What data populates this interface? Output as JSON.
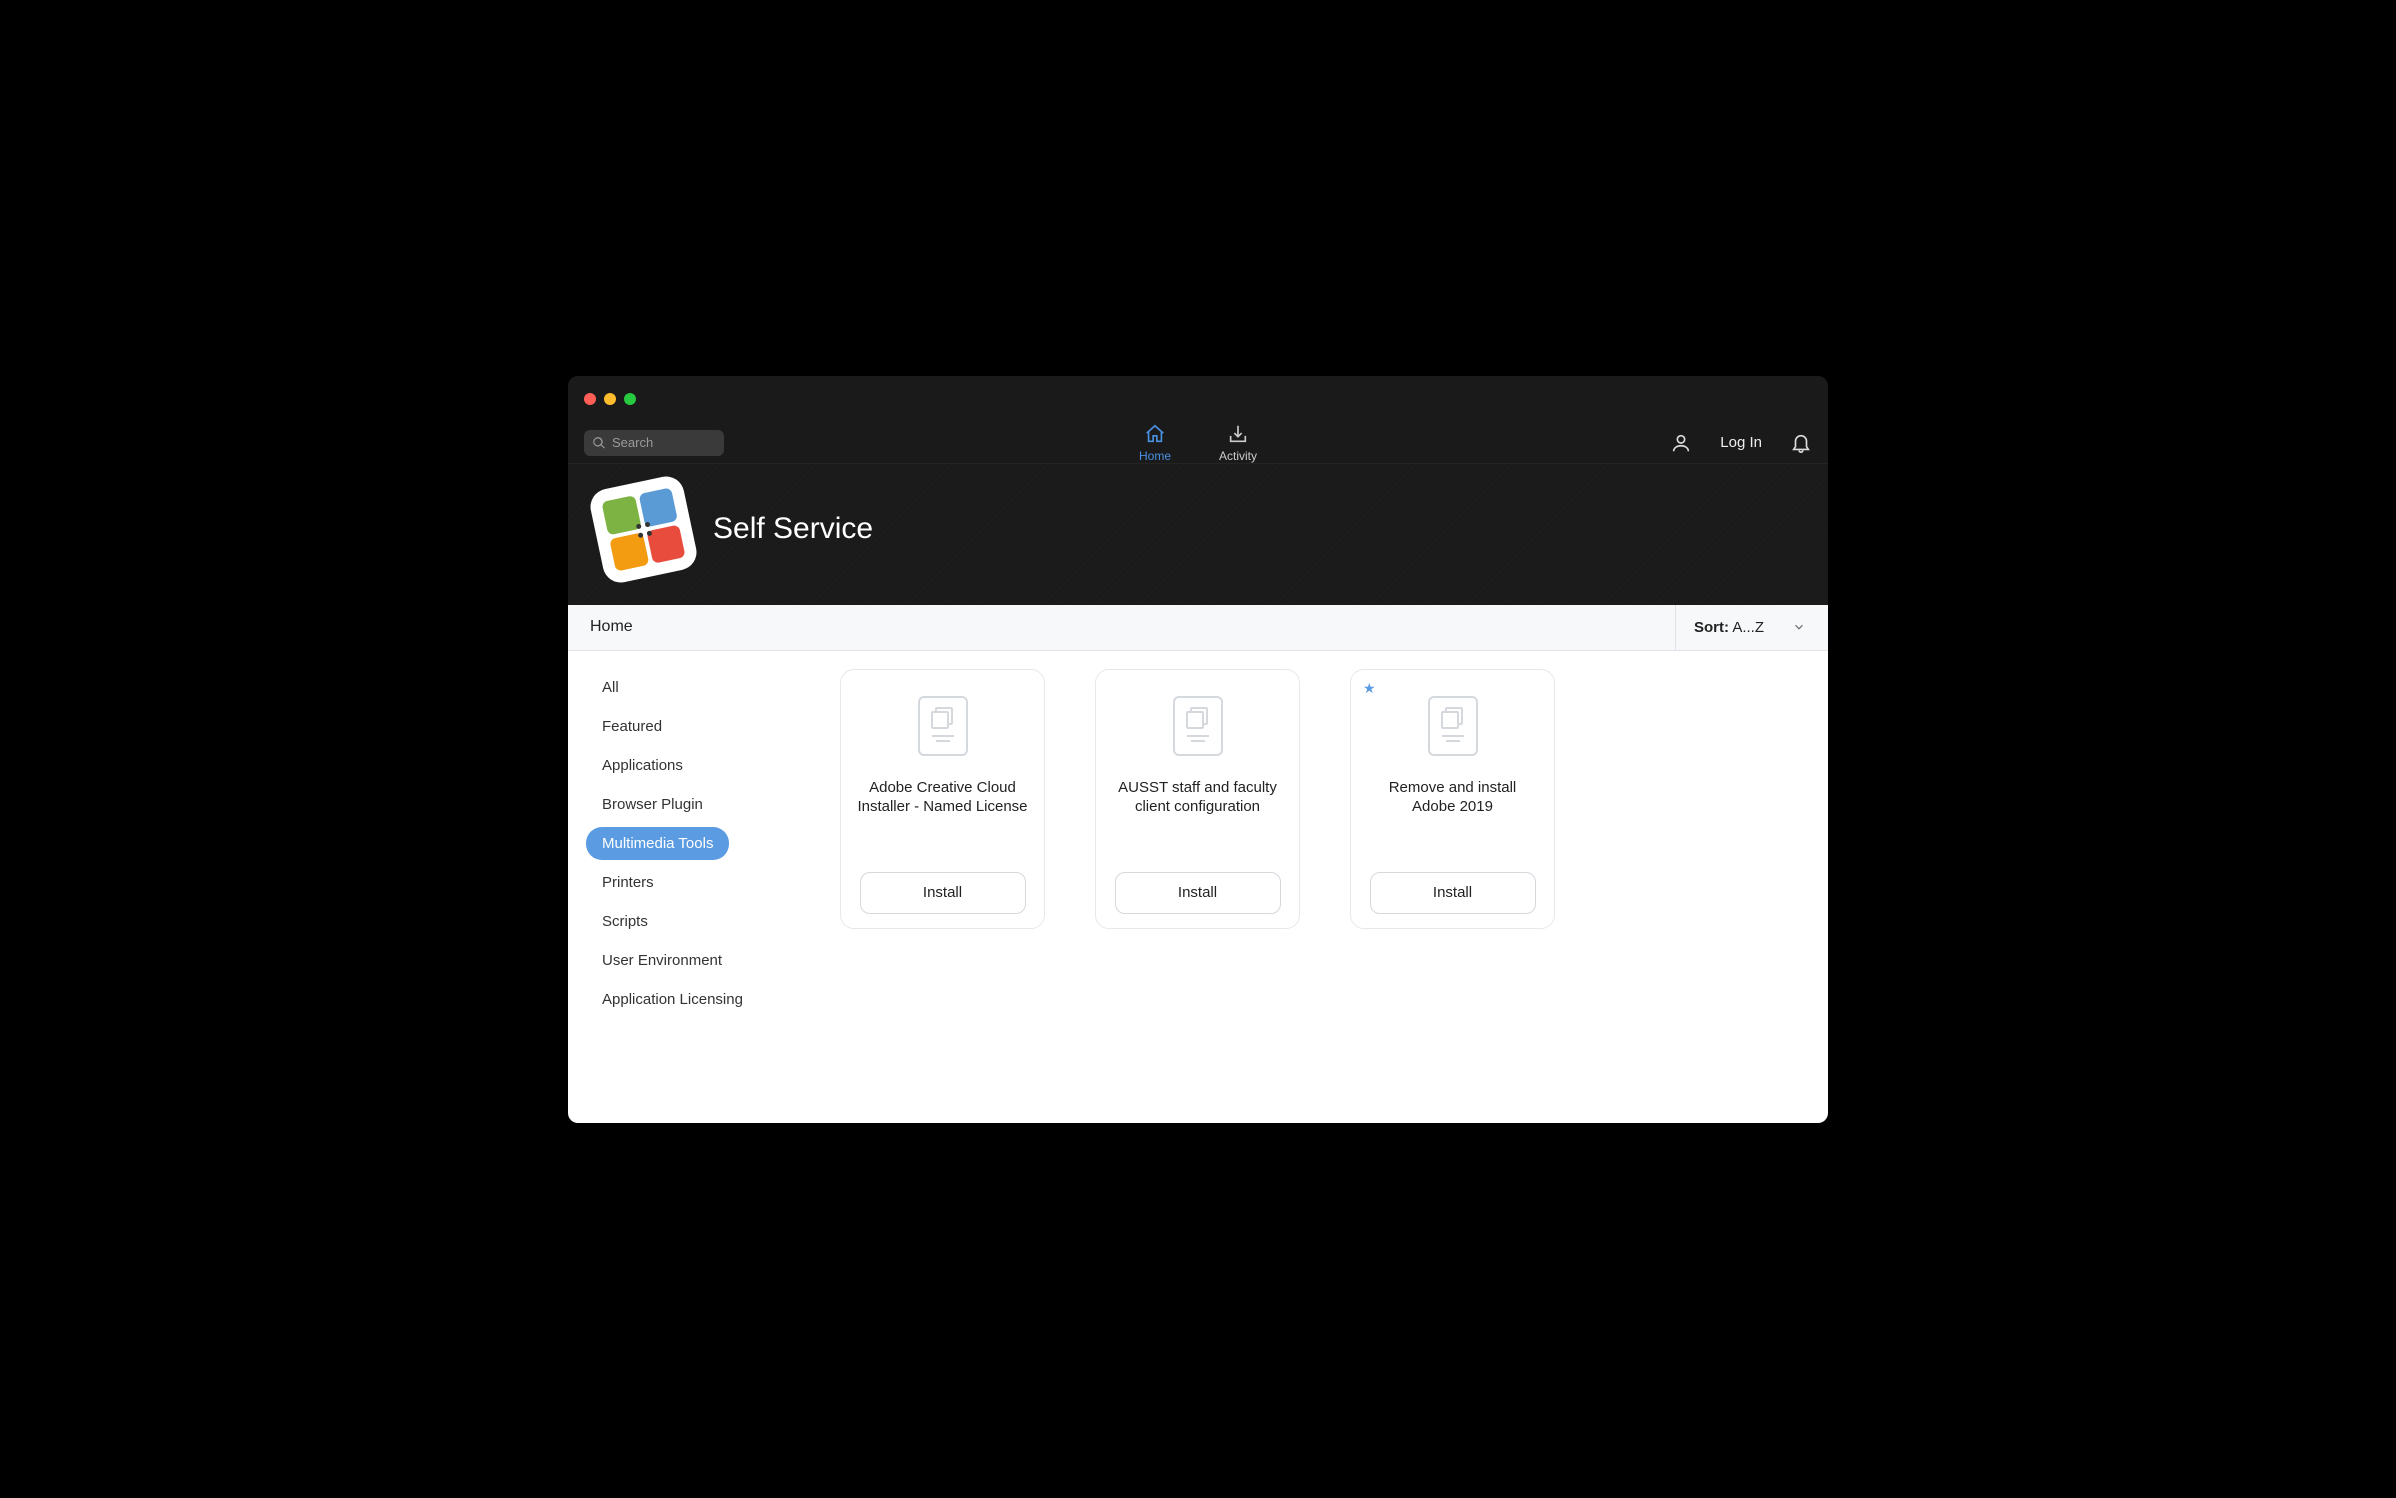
{
  "search": {
    "placeholder": "Search"
  },
  "nav": {
    "home": "Home",
    "activity": "Activity"
  },
  "auth": {
    "login": "Log In"
  },
  "app": {
    "title": "Self Service"
  },
  "breadcrumb": "Home",
  "sort": {
    "label": "Sort:",
    "value": "A...Z"
  },
  "sidebar": {
    "items": [
      {
        "label": "All",
        "active": false
      },
      {
        "label": "Featured",
        "active": false
      },
      {
        "label": "Applications",
        "active": false
      },
      {
        "label": "Browser Plugin",
        "active": false
      },
      {
        "label": "Multimedia Tools",
        "active": true
      },
      {
        "label": "Printers",
        "active": false
      },
      {
        "label": "Scripts",
        "active": false
      },
      {
        "label": "User Environment",
        "active": false
      },
      {
        "label": "Application Licensing",
        "active": false
      }
    ]
  },
  "cards": [
    {
      "title": "Adobe Creative Cloud Installer - Named License",
      "button": "Install",
      "featured": false
    },
    {
      "title": "AUSST staff and faculty client configuration",
      "button": "Install",
      "featured": false
    },
    {
      "title": "Remove and install Adobe 2019",
      "button": "Install",
      "featured": true
    }
  ]
}
